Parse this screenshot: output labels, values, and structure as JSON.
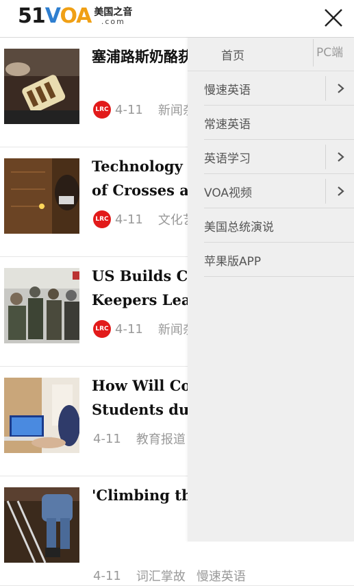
{
  "header": {
    "logo_num": "51",
    "logo_voa_v": "V",
    "logo_voa_oa": "OA",
    "logo_cn": "美国之音",
    "logo_domain": ".com"
  },
  "articles": [
    {
      "title_lines": [
        "塞浦路斯奶酪获"
      ],
      "date": "4-11",
      "category": "新闻杂",
      "has_lrc": true
    },
    {
      "title_lines": [
        "Technology F",
        "of Crosses at"
      ],
      "date": "4-11",
      "category": "文化艺",
      "has_lrc": true
    },
    {
      "title_lines": [
        "US Builds Ca",
        "Keepers Lead"
      ],
      "date": "4-11",
      "category": "新闻杂",
      "has_lrc": true
    },
    {
      "title_lines": [
        "How Will Col",
        "Students dur"
      ],
      "date": "4-11",
      "category": "教育报道",
      "has_lrc": false
    },
    {
      "title_lines": [
        "'Climbing the"
      ],
      "date": "4-11",
      "category": "词汇掌故",
      "category2": "慢速英语",
      "has_lrc": false
    }
  ],
  "lrc_badge": "LRC",
  "drawer": {
    "home": "首页",
    "pc": "PC端",
    "items": [
      {
        "label": "慢速英语",
        "has_arrow": true
      },
      {
        "label": "常速英语",
        "has_arrow": false
      },
      {
        "label": "英语学习",
        "has_arrow": true
      },
      {
        "label": "VOA视频",
        "has_arrow": true
      },
      {
        "label": "美国总统演说",
        "has_arrow": false
      },
      {
        "label": "苹果版APP",
        "has_arrow": false
      }
    ]
  },
  "icons": {
    "close": "close-icon",
    "arrow": "chevron-right-icon"
  }
}
